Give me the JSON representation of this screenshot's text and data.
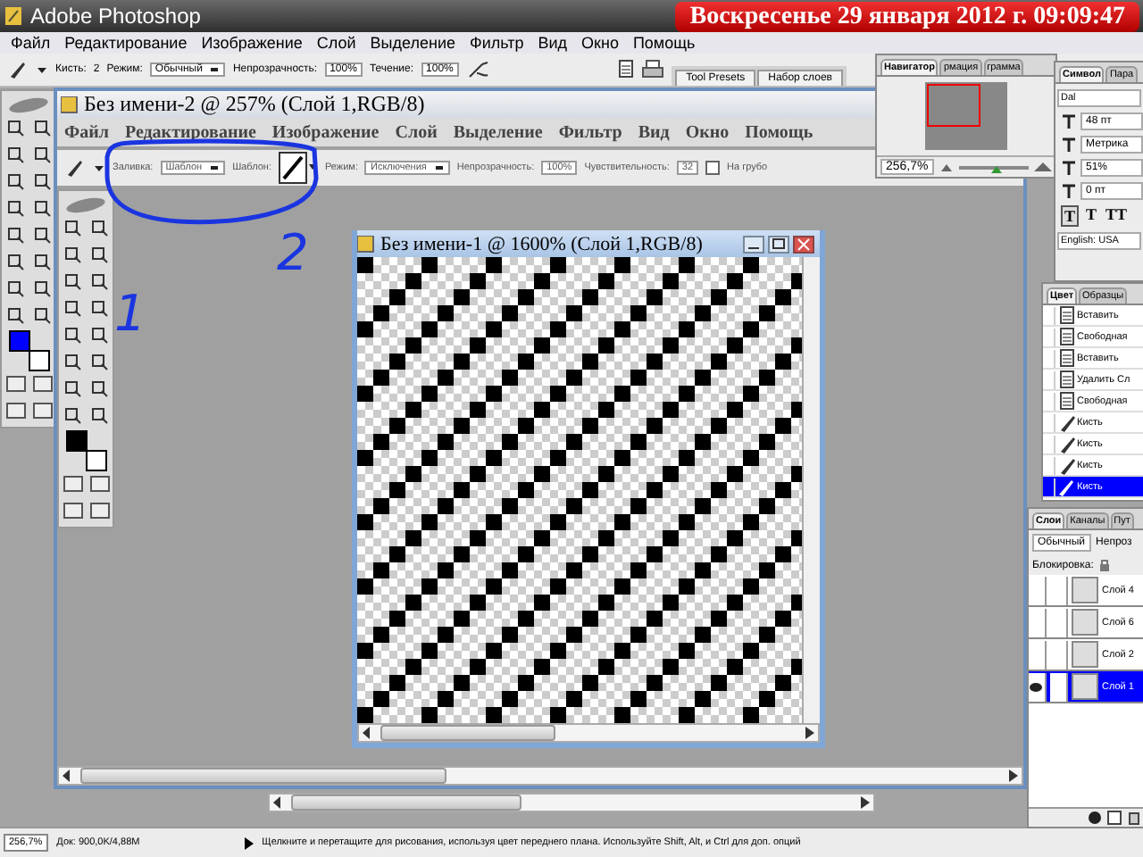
{
  "title_bar": {
    "title": "Adobe Photoshop",
    "clock": "Воскресенье  29 января 2012 г.  09:09:47"
  },
  "menu": [
    "Файл",
    "Редактирование",
    "Изображение",
    "Слой",
    "Выделение",
    "Фильтр",
    "Вид",
    "Окно",
    "Помощь"
  ],
  "options_bar": {
    "items": [
      {
        "kind": "brush_picker"
      },
      {
        "kind": "label",
        "text": "Кисть:"
      },
      {
        "kind": "value",
        "text": "2"
      },
      {
        "kind": "label",
        "text": "Режим:"
      },
      {
        "kind": "dropdown",
        "text": "Обычный"
      },
      {
        "kind": "label",
        "text": "Непрозрачность:"
      },
      {
        "kind": "field",
        "text": "100%"
      },
      {
        "kind": "label",
        "text": "Течение:"
      },
      {
        "kind": "field",
        "text": "100%"
      },
      {
        "kind": "airbrush"
      }
    ],
    "palette_well": [
      "Tool Presets",
      "Набор слоев"
    ]
  },
  "toolbox": {
    "swatches": [
      {
        "kind": "foreground",
        "color": "#0000ff"
      },
      {
        "kind": "background",
        "color": "#ffffff"
      }
    ]
  },
  "screenshot_window": {
    "title": "Без имени-2 @ 257% (Слой 1,RGB/8)",
    "menu": [
      "Файл",
      "Редактирование",
      "Изображение",
      "Слой",
      "Выделение",
      "Фильтр",
      "Вид",
      "Окно",
      "Помощь"
    ],
    "options_bar": [
      {
        "kind": "brush_picker"
      },
      {
        "kind": "label",
        "text": "Заливка:"
      },
      {
        "kind": "dropdown",
        "text": "Шаблон"
      },
      {
        "kind": "label",
        "text": "Шаблон:"
      },
      {
        "kind": "pattern_picker"
      },
      {
        "kind": "label",
        "text": "Режим:"
      },
      {
        "kind": "dropdown",
        "text": "Исключения"
      },
      {
        "kind": "label",
        "text": "Непрозрачность:"
      },
      {
        "kind": "field",
        "text": "100%"
      },
      {
        "kind": "label",
        "text": "Чувствительность:"
      },
      {
        "kind": "field",
        "text": "32"
      },
      {
        "kind": "checkbox",
        "text": "На грубо",
        "checked": false
      }
    ],
    "toolbox": {
      "swatches": [
        {
          "kind": "foreground",
          "color": "#000000"
        },
        {
          "kind": "background",
          "color": "#ffffff"
        }
      ]
    },
    "document_window": {
      "title": "Без имени-1 @ 1600% (Слой 1,RGB/8)"
    }
  },
  "annotations": [
    "2",
    "1"
  ],
  "navigator": {
    "tabs": [
      {
        "label": "Навигатор",
        "selected": true
      },
      {
        "label": "рмация",
        "selected": false
      },
      {
        "label": "грамма",
        "selected": false
      }
    ],
    "zoom": "256,7%",
    "level": 0.55
  },
  "character": {
    "tabs": [
      {
        "label": "Символ",
        "selected": true
      },
      {
        "label": "Пара",
        "selected": false
      }
    ],
    "font": "Dal",
    "size": "48 пт",
    "kerning": "Метрика",
    "scale": "51%",
    "baseline": "0 пт",
    "styles": [
      {
        "text": "T",
        "selected": true
      },
      {
        "text": "T",
        "selected": false
      },
      {
        "text": "TT",
        "selected": false
      }
    ],
    "language": "English: USA"
  },
  "history": {
    "tabs": [
      {
        "label": "Цвет",
        "selected": true
      },
      {
        "label": "Образцы",
        "selected": false
      }
    ],
    "items": [
      {
        "kind": "document",
        "text": "Вставить",
        "selected": false
      },
      {
        "kind": "document",
        "text": "Свободная",
        "selected": false
      },
      {
        "kind": "document",
        "text": "Вставить",
        "selected": false
      },
      {
        "kind": "document",
        "text": "Удалить Сл",
        "selected": false
      },
      {
        "kind": "document",
        "text": "Свободная",
        "selected": false
      },
      {
        "kind": "brush",
        "text": "Кисть",
        "selected": false
      },
      {
        "kind": "brush",
        "text": "Кисть",
        "selected": false
      },
      {
        "kind": "brush",
        "text": "Кисть",
        "selected": false
      },
      {
        "kind": "brush",
        "text": "Кисть",
        "selected": true
      }
    ]
  },
  "layers": {
    "tabs": [
      {
        "label": "Слои",
        "selected": true
      },
      {
        "label": "Каналы",
        "selected": false
      },
      {
        "label": "Пут",
        "selected": false
      }
    ],
    "blend_mode": "Обычный",
    "opacity_label": "Непроз",
    "lock_label": "Блокировка:",
    "items": [
      {
        "name": "Слой 4",
        "visible": false,
        "selected": false
      },
      {
        "name": "Слой 6",
        "visible": false,
        "selected": false
      },
      {
        "name": "Слой 2",
        "visible": false,
        "selected": false
      },
      {
        "name": "Слой 1",
        "visible": true,
        "selected": true
      }
    ]
  },
  "status_bar": {
    "zoom": "256,7%",
    "document": "Док: 900,0K/4,88M",
    "hint": "Щелкните и перетащите для рисования, используя цвет переднего плана. Используйте Shift, Alt, и Ctrl для доп. опций"
  }
}
